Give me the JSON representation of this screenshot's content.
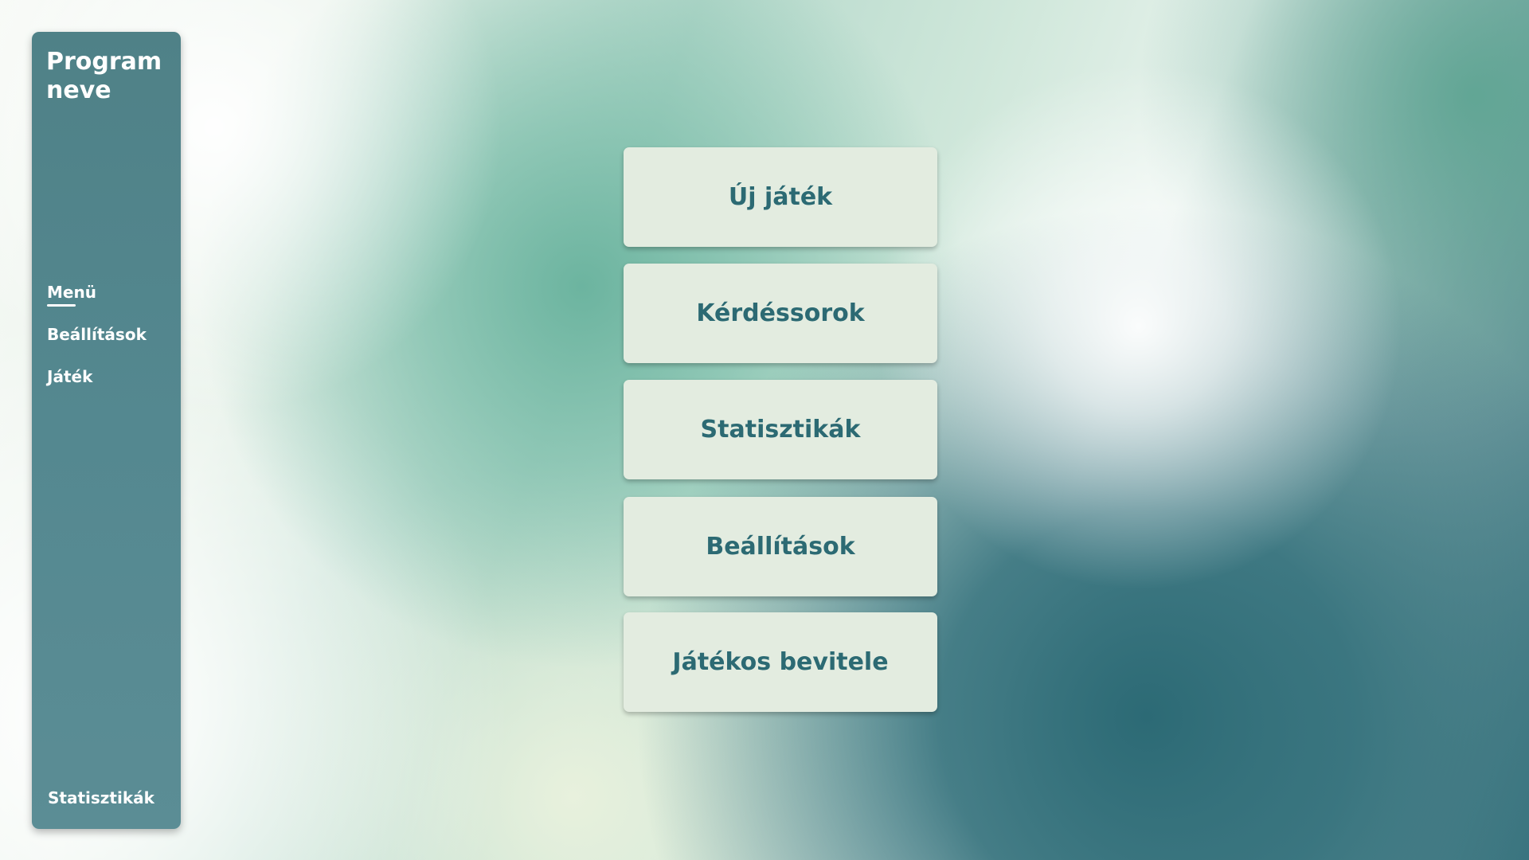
{
  "app": {
    "title": "Program neve"
  },
  "sidebar": {
    "items": [
      {
        "label": "Menü",
        "active": true
      },
      {
        "label": "Beállítások",
        "active": false
      },
      {
        "label": "Játék",
        "active": false
      }
    ],
    "bottom_item": {
      "label": "Statisztikák"
    }
  },
  "main": {
    "buttons": [
      {
        "label": "Új játék"
      },
      {
        "label": "Kérdéssorok"
      },
      {
        "label": "Statisztikák"
      },
      {
        "label": "Beállítások"
      },
      {
        "label": "Játékos bevitele"
      }
    ]
  },
  "colors": {
    "sidebar": "#548890",
    "button_background": "#e3ece0",
    "button_text": "#2c6a73",
    "sidebar_text": "#ffffff"
  }
}
